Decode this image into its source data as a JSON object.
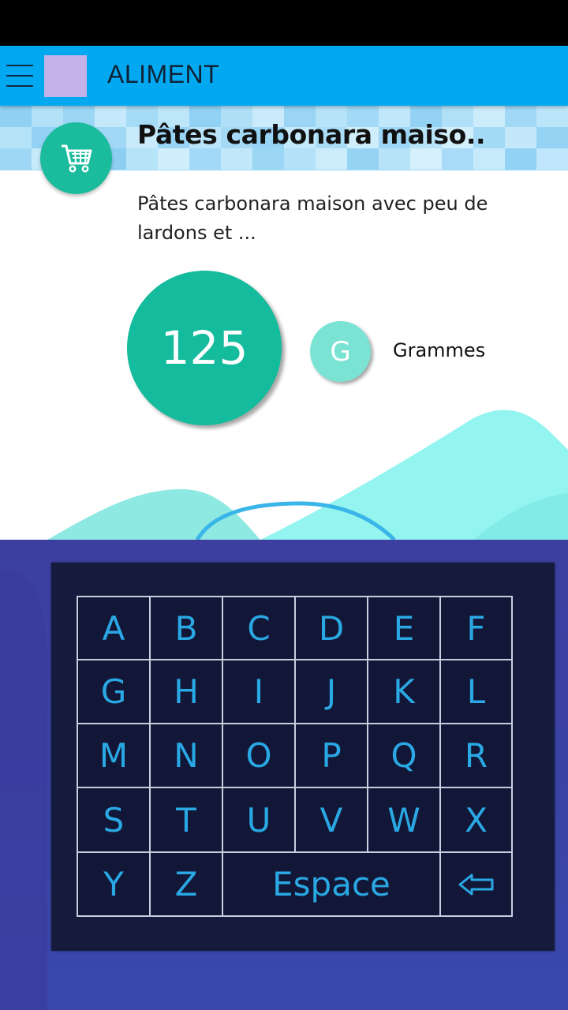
{
  "app_bar": {
    "title": "ALIMENT"
  },
  "food": {
    "title": "Pâtes carbonara maiso..",
    "description": "Pâtes carbonara maison avec peu de lardons et ...",
    "quantity": "125",
    "unit_letter": "G",
    "unit_label": "Grammes"
  },
  "keyboard": {
    "rows": [
      [
        "A",
        "B",
        "C",
        "D",
        "E",
        "F"
      ],
      [
        "G",
        "H",
        "I",
        "J",
        "K",
        "L"
      ],
      [
        "M",
        "N",
        "O",
        "P",
        "Q",
        "R"
      ],
      [
        "S",
        "T",
        "U",
        "V",
        "W",
        "X"
      ]
    ],
    "last_row": {
      "y": "Y",
      "z": "Z",
      "space": "Espace",
      "backspace_icon": "backspace-arrow-icon"
    }
  },
  "colors": {
    "app_bar": "#03a9f0",
    "accent_teal": "#14bb9d",
    "unit_circle": "#7ae3d4",
    "keyboard_overlay": "#3c3fa0",
    "keyboard_panel": "#141b3c",
    "key_text": "#2aa8e4"
  }
}
